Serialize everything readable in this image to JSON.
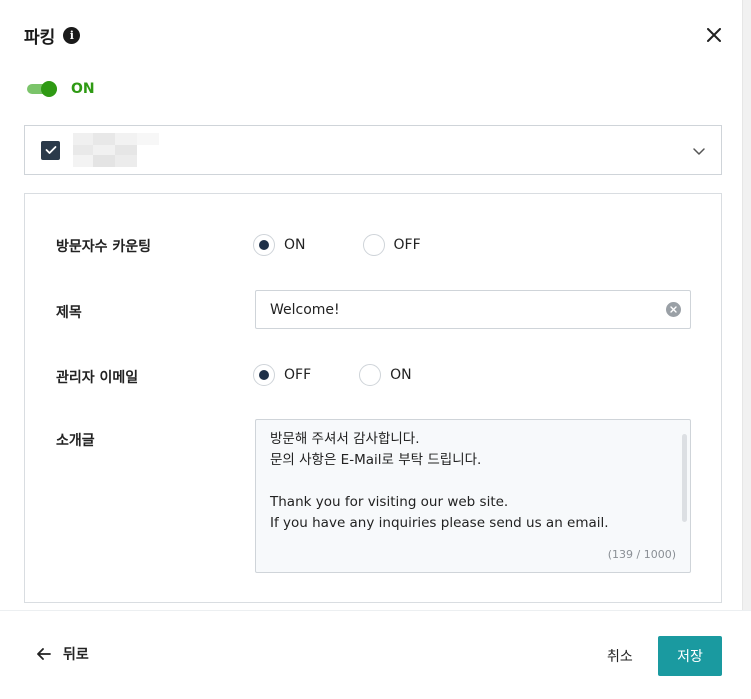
{
  "header": {
    "title": "파킹",
    "info_icon": "info-icon",
    "close_icon": "close-icon"
  },
  "toggle": {
    "state_label": "ON",
    "enabled": true,
    "color": "#2f9a14"
  },
  "selector": {
    "checked": true
  },
  "form": {
    "visitor_counting": {
      "label": "방문자수 카운팅",
      "options": [
        "ON",
        "OFF"
      ],
      "selected": "ON"
    },
    "title_field": {
      "label": "제목",
      "value": "Welcome!"
    },
    "admin_email": {
      "label": "관리자 이메일",
      "options": [
        "OFF",
        "ON"
      ],
      "selected": "OFF"
    },
    "intro": {
      "label": "소개글",
      "text": "방문해 주셔서 감사합니다.\n문의 사항은 E-Mail로 부탁 드립니다.\n\nThank you for visiting our web site.\nIf you have any inquiries please send us an email.",
      "char_count": "(139 / 1000)"
    }
  },
  "footer": {
    "back_label": "뒤로",
    "cancel_label": "취소",
    "save_label": "저장",
    "save_color": "#1a9aa0"
  }
}
